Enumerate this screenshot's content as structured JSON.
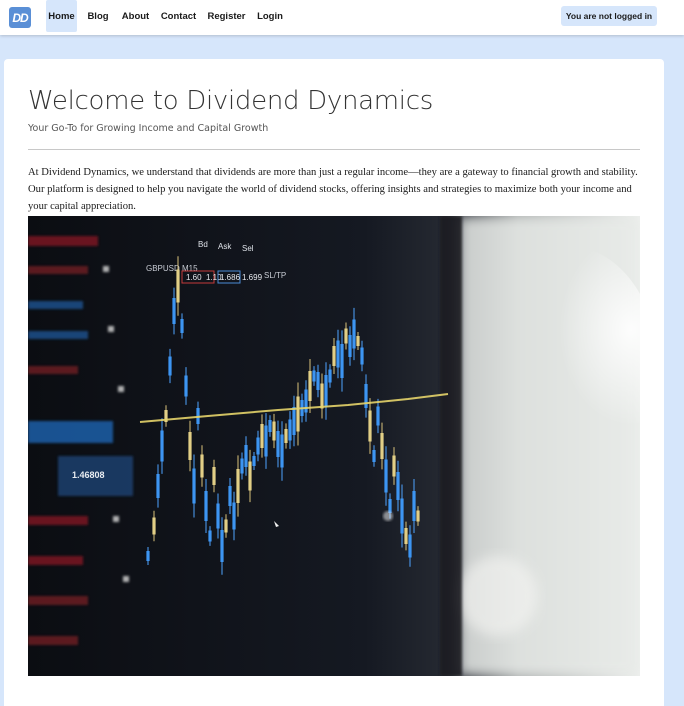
{
  "navbar": {
    "logo_text": "DD",
    "items": [
      {
        "label": "Home",
        "active": true
      },
      {
        "label": "Blog"
      },
      {
        "label": "About"
      },
      {
        "label": "Contact"
      },
      {
        "label": "Register"
      },
      {
        "label": "Login"
      }
    ],
    "status": "You are not logged in"
  },
  "main": {
    "title": "Welcome to Dividend Dynamics",
    "subtitle": "Your Go-To for Growing Income and Capital Growth",
    "intro": "At Dividend Dynamics, we understand that dividends are more than just a regular income—they are a gateway to financial growth and stability. Our platform is designed to help you navigate the world of dividend stocks, offering insights and strategies to maximize both your income and your capital appreciation.",
    "hero_image": {
      "subject": "trading-screen-candlestick-chart",
      "screen_labels": {
        "ticker": "GBPUSD M15",
        "bid": "Bd",
        "ask": "Ask",
        "sell": "Sel",
        "price_a": "1.60",
        "price_b": "1.10",
        "price_c": "1.686",
        "price_d": "1.699",
        "sl_tp": "SL/TP",
        "big_value": "1.46808"
      }
    }
  },
  "colors": {
    "page_bg": "#d6e6fb",
    "accent": "#5a8fd6",
    "card_bg": "#ffffff"
  }
}
